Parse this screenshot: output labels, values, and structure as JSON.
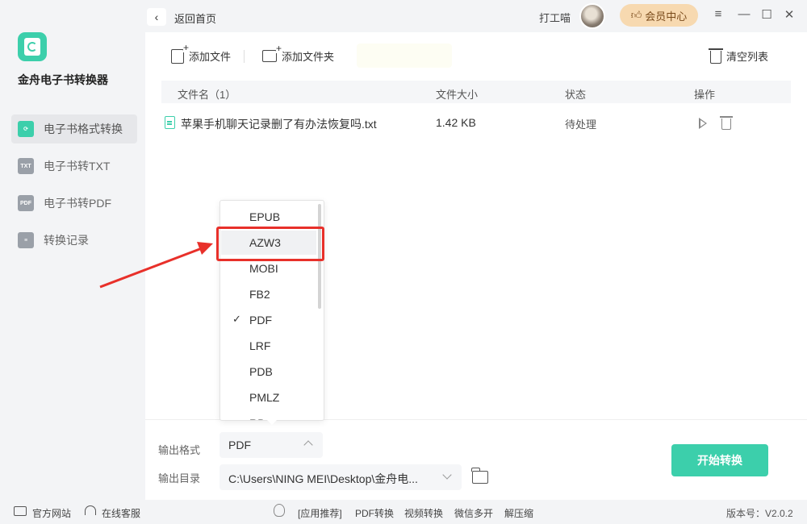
{
  "app": {
    "name": "金舟电子书转换器",
    "accent_color": "#3ccfab"
  },
  "sidebar": {
    "items": [
      {
        "label": "电子书格式转换",
        "icon": "refresh-book-icon",
        "active": true
      },
      {
        "label": "电子书转TXT",
        "icon": "txt-icon",
        "icon_text": "TXT"
      },
      {
        "label": "电子书转PDF",
        "icon": "pdf-icon",
        "icon_text": "PDF"
      },
      {
        "label": "转换记录",
        "icon": "record-list-icon"
      }
    ]
  },
  "topbar": {
    "back_label": "返回首页",
    "user_name": "打工喵",
    "vip_label": "会员中心",
    "window_controls": [
      "menu-icon",
      "minimize-icon",
      "maximize-icon",
      "close-icon"
    ]
  },
  "toolbar": {
    "add_file": "添加文件",
    "add_folder": "添加文件夹",
    "clear_list": "清空列表"
  },
  "table": {
    "headers": [
      "文件名（1）",
      "文件大小",
      "状态",
      "操作"
    ],
    "rows": [
      {
        "name": "苹果手机聊天记录删了有办法恢复吗.txt",
        "size": "1.42 KB",
        "status": "待处理"
      }
    ]
  },
  "dropdown": {
    "options": [
      "EPUB",
      "AZW3",
      "MOBI",
      "FB2",
      "PDF",
      "LRF",
      "PDB",
      "PMLZ",
      "RB"
    ],
    "hovered": "AZW3",
    "checked": "PDF"
  },
  "output": {
    "format_label": "输出格式",
    "format_value": "PDF",
    "dir_label": "输出目录",
    "dir_value": "C:\\Users\\NING MEI\\Desktop\\金舟电...",
    "start_button": "开始转换"
  },
  "footer": {
    "website": "官方网站",
    "support": "在线客服",
    "recommend": "[应用推荐]",
    "links": [
      "PDF转换",
      "视频转换",
      "微信多开",
      "解压缩"
    ],
    "version": "版本号：V2.0.2"
  },
  "annotation": {
    "highlight_color": "#e8302a"
  }
}
